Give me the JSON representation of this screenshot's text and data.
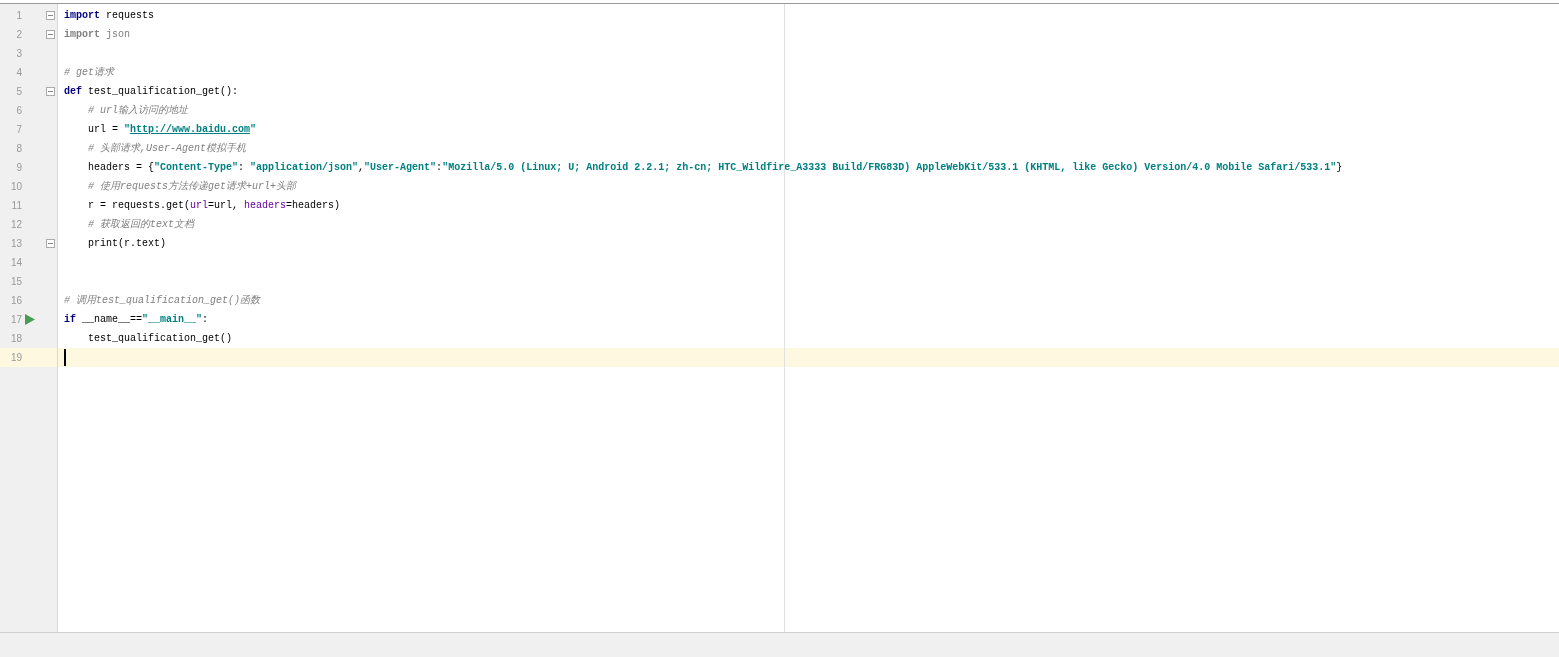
{
  "lines": [
    {
      "number": "1",
      "fold_marker": true,
      "run_marker": false,
      "current": false,
      "indented": false,
      "tokens": [
        {
          "kind": "keyword",
          "text": "import"
        },
        {
          "kind": "plain",
          "text": " requests"
        }
      ]
    },
    {
      "number": "2",
      "fold_marker": true,
      "run_marker": false,
      "current": false,
      "indented": false,
      "tokens": [
        {
          "kind": "keyword-unused",
          "text": "import"
        },
        {
          "kind": "unused",
          "text": " json"
        }
      ]
    },
    {
      "number": "3",
      "fold_marker": false,
      "run_marker": false,
      "current": false
    },
    {
      "number": "4",
      "fold_marker": false,
      "run_marker": false,
      "current": false,
      "indented": false,
      "tokens": [
        {
          "kind": "comment",
          "text": "# get请求"
        }
      ]
    },
    {
      "number": "5",
      "fold_marker": true,
      "run_marker": false,
      "current": false,
      "indented": false,
      "tokens": [
        {
          "kind": "keyword",
          "text": "def"
        },
        {
          "kind": "plain",
          "text": " test_qualification_get():"
        }
      ]
    },
    {
      "number": "6",
      "fold_marker": false,
      "run_marker": false,
      "current": false,
      "indented": true,
      "tokens": [
        {
          "kind": "comment",
          "text": "# url输入访问的地址"
        }
      ]
    },
    {
      "number": "7",
      "fold_marker": false,
      "run_marker": false,
      "current": false,
      "indented": true,
      "tokens": [
        {
          "kind": "plain",
          "text": "url = "
        },
        {
          "kind": "string",
          "text": "\""
        },
        {
          "kind": "url",
          "text": "http://www.baidu.com"
        },
        {
          "kind": "string",
          "text": "\""
        }
      ]
    },
    {
      "number": "8",
      "fold_marker": false,
      "run_marker": false,
      "current": false,
      "indented": true,
      "tokens": [
        {
          "kind": "comment",
          "text": "# 头部请求,User-Agent模拟手机"
        }
      ]
    },
    {
      "number": "9",
      "fold_marker": false,
      "run_marker": false,
      "current": false,
      "indented": true,
      "tokens": [
        {
          "kind": "plain",
          "text": "headers = {"
        },
        {
          "kind": "string",
          "text": "\"Content-Type\""
        },
        {
          "kind": "plain",
          "text": ": "
        },
        {
          "kind": "string",
          "text": "\"application/json\""
        },
        {
          "kind": "plain",
          "text": ","
        },
        {
          "kind": "string",
          "text": "\"User-Agent\""
        },
        {
          "kind": "plain",
          "text": ":"
        },
        {
          "kind": "string",
          "text": "\"Mozilla/5.0 (Linux; U; Android 2.2.1; zh-cn; HTC_Wildfire_A3333 Build/FRG83D) AppleWebKit/533.1 (KHTML, like Gecko) Version/4.0 Mobile Safari/533.1\""
        },
        {
          "kind": "plain",
          "text": "}"
        }
      ]
    },
    {
      "number": "10",
      "fold_marker": false,
      "run_marker": false,
      "current": false,
      "indented": true,
      "tokens": [
        {
          "kind": "comment",
          "text": "# 使用requests方法传递get请求+url+头部"
        }
      ]
    },
    {
      "number": "11",
      "fold_marker": false,
      "run_marker": false,
      "current": false,
      "indented": true,
      "tokens": [
        {
          "kind": "plain",
          "text": "r = requests.get("
        },
        {
          "kind": "param",
          "text": "url"
        },
        {
          "kind": "plain",
          "text": "=url, "
        },
        {
          "kind": "param",
          "text": "headers"
        },
        {
          "kind": "plain",
          "text": "=headers)"
        }
      ]
    },
    {
      "number": "12",
      "fold_marker": false,
      "run_marker": false,
      "current": false,
      "indented": true,
      "tokens": [
        {
          "kind": "comment",
          "text": "# 获取返回的text文档"
        }
      ]
    },
    {
      "number": "13",
      "fold_marker": true,
      "run_marker": false,
      "current": false,
      "indented": true,
      "tokens": [
        {
          "kind": "plain",
          "text": "print(r.text)"
        }
      ]
    },
    {
      "number": "14",
      "fold_marker": false,
      "run_marker": false,
      "current": false
    },
    {
      "number": "15",
      "fold_marker": false,
      "run_marker": false,
      "current": false
    },
    {
      "number": "16",
      "fold_marker": false,
      "run_marker": false,
      "current": false,
      "indented": false,
      "tokens": [
        {
          "kind": "comment",
          "text": "# 调用test_qualification_get()函数"
        }
      ]
    },
    {
      "number": "17",
      "fold_marker": false,
      "run_marker": true,
      "current": false,
      "indented": false,
      "tokens": [
        {
          "kind": "keyword",
          "text": "if"
        },
        {
          "kind": "plain",
          "text": " __name__=="
        },
        {
          "kind": "string",
          "text": "\"__main__\""
        },
        {
          "kind": "plain",
          "text": ":"
        }
      ]
    },
    {
      "number": "18",
      "fold_marker": false,
      "run_marker": false,
      "current": false,
      "indented": true,
      "tokens": [
        {
          "kind": "plain",
          "text": "test_qualification_get()"
        }
      ]
    },
    {
      "number": "19",
      "fold_marker": false,
      "run_marker": false,
      "current": true
    }
  ]
}
